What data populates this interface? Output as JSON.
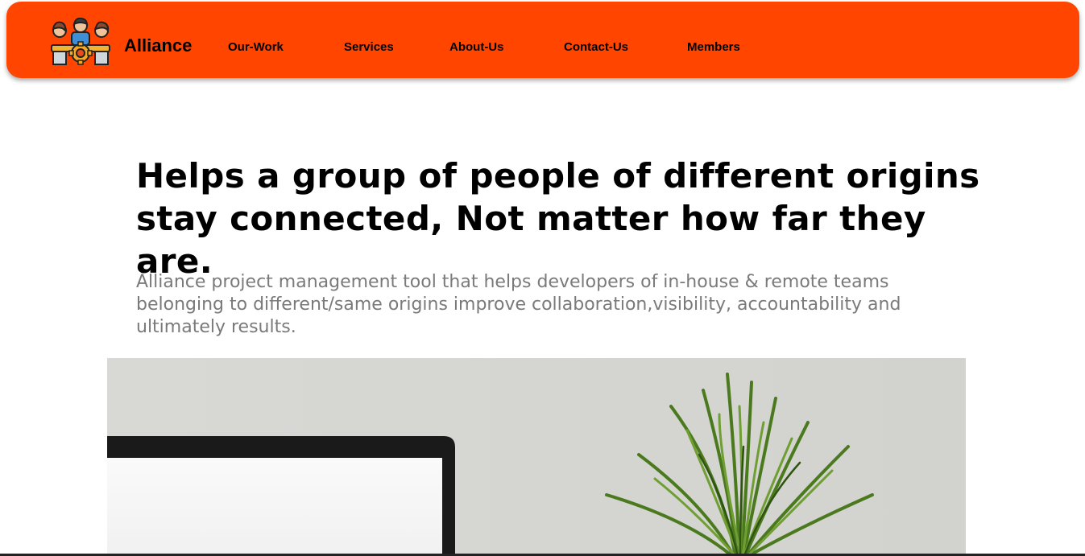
{
  "navbar": {
    "background": "#ff4500",
    "logo_icon": "team-collaboration-icon",
    "brand": "Alliance",
    "links": [
      "Our-Work",
      "Services",
      "About-Us",
      "Contact-Us",
      "Members"
    ]
  },
  "hero": {
    "headline": "Helps a group of people of different origins stay connected, Not matter how far they are.",
    "description": "Alliance project management tool that helps developers of in-house & remote teams belonging to different/same origins improve collaboration,visibility, accountability and ultimately results.",
    "image_icon": "laptop-and-plant-photo"
  }
}
